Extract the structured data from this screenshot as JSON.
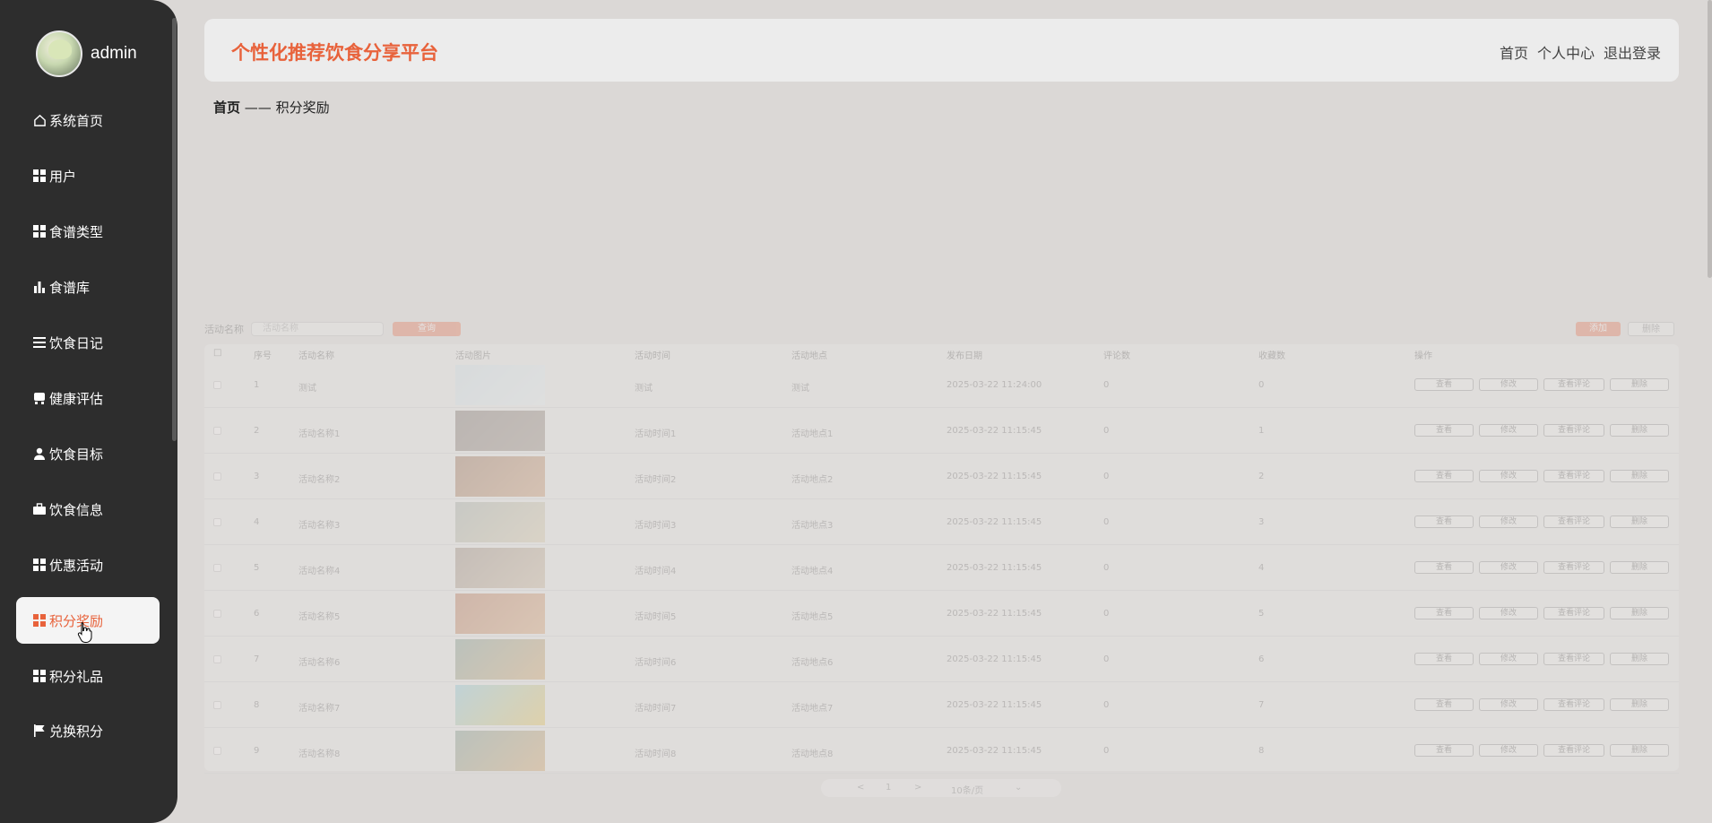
{
  "sidebar": {
    "username": "admin",
    "items": [
      {
        "label": "系统首页",
        "icon": "home-icon"
      },
      {
        "label": "用户",
        "icon": "grid-icon"
      },
      {
        "label": "食谱类型",
        "icon": "grid-icon"
      },
      {
        "label": "食谱库",
        "icon": "bar-chart-icon"
      },
      {
        "label": "饮食日记",
        "icon": "list-icon"
      },
      {
        "label": "健康评估",
        "icon": "card-icon"
      },
      {
        "label": "饮食目标",
        "icon": "user-icon"
      },
      {
        "label": "饮食信息",
        "icon": "briefcase-icon"
      },
      {
        "label": "优惠活动",
        "icon": "grid-icon"
      },
      {
        "label": "积分奖励",
        "icon": "grid-icon",
        "active": true
      },
      {
        "label": "积分礼品",
        "icon": "grid-icon"
      },
      {
        "label": "兑换积分",
        "icon": "flag-icon"
      }
    ]
  },
  "header": {
    "title": "个性化推荐饮食分享平台",
    "links": [
      "首页",
      "个人中心",
      "退出登录"
    ]
  },
  "breadcrumb": {
    "home": "首页",
    "separator": "——",
    "current": "积分奖励"
  },
  "search": {
    "label": "活动名称",
    "placeholder": "活动名称",
    "button": "查询"
  },
  "actions": {
    "add": "添加",
    "delete": "删除"
  },
  "table": {
    "columns": [
      "序号",
      "活动名称",
      "活动图片",
      "活动时间",
      "活动地点",
      "发布日期",
      "评论数",
      "收藏数",
      "操作"
    ],
    "rows": [
      {
        "no": "1",
        "name": "测试",
        "time": "测试",
        "place": "测试",
        "date": "2025-03-22 11:24:00",
        "comments": "0",
        "favorites": "0"
      },
      {
        "no": "2",
        "name": "活动名称1",
        "time": "活动时间1",
        "place": "活动地点1",
        "date": "2025-03-22 11:15:45",
        "comments": "0",
        "favorites": "1"
      },
      {
        "no": "3",
        "name": "活动名称2",
        "time": "活动时间2",
        "place": "活动地点2",
        "date": "2025-03-22 11:15:45",
        "comments": "0",
        "favorites": "2"
      },
      {
        "no": "4",
        "name": "活动名称3",
        "time": "活动时间3",
        "place": "活动地点3",
        "date": "2025-03-22 11:15:45",
        "comments": "0",
        "favorites": "3"
      },
      {
        "no": "5",
        "name": "活动名称4",
        "time": "活动时间4",
        "place": "活动地点4",
        "date": "2025-03-22 11:15:45",
        "comments": "0",
        "favorites": "4"
      },
      {
        "no": "6",
        "name": "活动名称5",
        "time": "活动时间5",
        "place": "活动地点5",
        "date": "2025-03-22 11:15:45",
        "comments": "0",
        "favorites": "5"
      },
      {
        "no": "7",
        "name": "活动名称6",
        "time": "活动时间6",
        "place": "活动地点6",
        "date": "2025-03-22 11:15:45",
        "comments": "0",
        "favorites": "6"
      },
      {
        "no": "8",
        "name": "活动名称7",
        "time": "活动时间7",
        "place": "活动地点7",
        "date": "2025-03-22 11:15:45",
        "comments": "0",
        "favorites": "7"
      },
      {
        "no": "9",
        "name": "活动名称8",
        "time": "活动时间8",
        "place": "活动地点8",
        "date": "2025-03-22 11:15:45",
        "comments": "0",
        "favorites": "8"
      }
    ],
    "row_buttons": [
      "查看",
      "修改",
      "查看评论",
      "删除"
    ]
  },
  "pagination": {
    "prev": "<",
    "page": "1",
    "next": ">",
    "page_size": "10条/页",
    "dropdown": "⌄"
  },
  "colors": {
    "accent": "#e8623b",
    "sidebar_bg": "#2d2d2d",
    "page_bg": "#dbd8d6"
  }
}
